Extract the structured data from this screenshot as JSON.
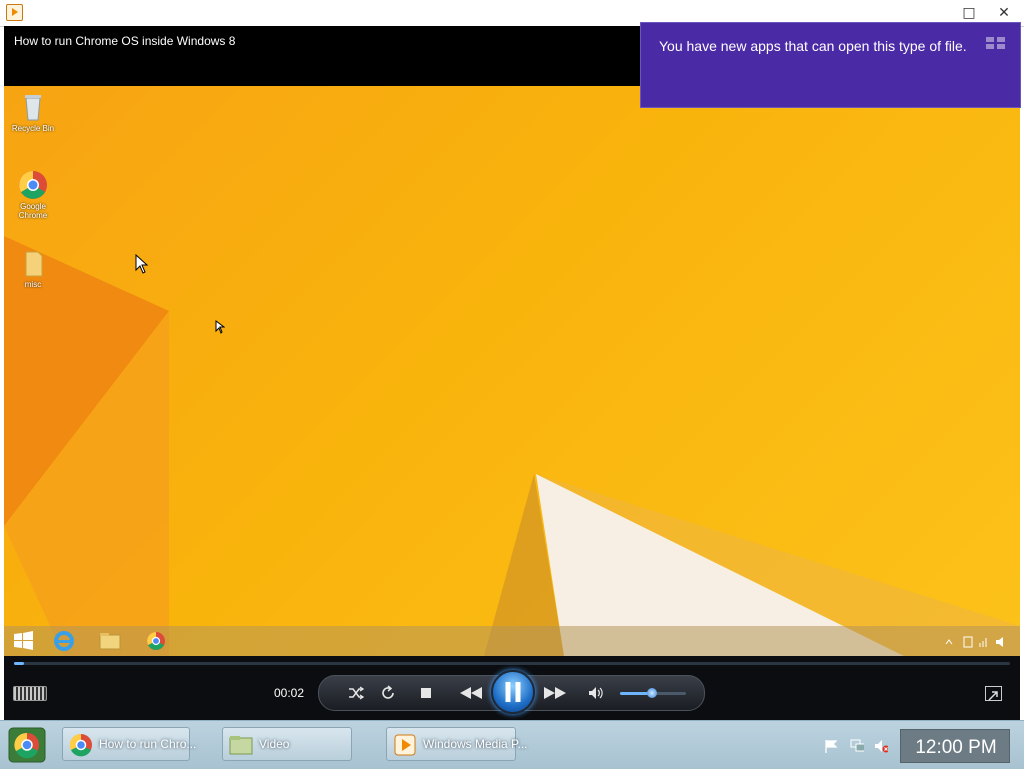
{
  "window": {
    "restore_icon": "maximize-icon",
    "close_icon": "close-icon"
  },
  "video": {
    "title": "How to run Chrome OS inside Windows 8",
    "desktop_icons": [
      {
        "label": "Recycle Bin",
        "icon": "recycle-bin-icon"
      },
      {
        "label": "Google Chrome",
        "icon": "chrome-icon"
      },
      {
        "label": "misc",
        "icon": "folder-icon"
      }
    ]
  },
  "notification": {
    "text": "You have new apps that can open this type of file."
  },
  "player": {
    "elapsed": "00:02",
    "progress": 0.01,
    "volume": 0.48,
    "colors": {
      "accent": "#6db6ff",
      "play": "#1f6fc7"
    }
  },
  "taskbar": {
    "tasks": [
      {
        "label": "How to run Chro...",
        "icon": "chrome-icon"
      },
      {
        "label": "Video",
        "icon": "folder-icon"
      },
      {
        "label": "Windows Media P...",
        "icon": "media-player-icon"
      }
    ],
    "clock": "12:00 PM"
  }
}
